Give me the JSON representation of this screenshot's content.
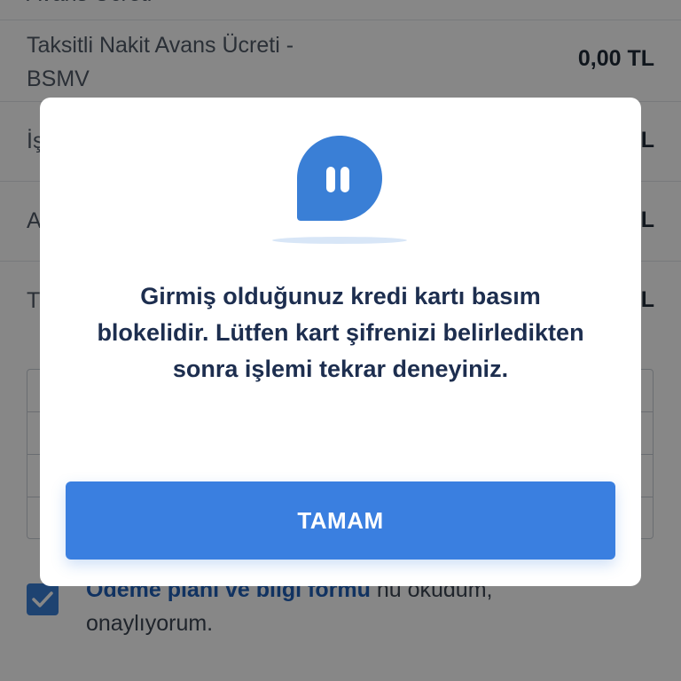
{
  "background": {
    "rows": [
      {
        "label": "Avans Ücreti",
        "value": ""
      },
      {
        "label": "Taksitli Nakit Avans Ücreti - BSMV",
        "value": "0,00 TL"
      },
      {
        "label": "İş",
        "value": "L"
      },
      {
        "label": "A",
        "value": "L"
      },
      {
        "label": "T",
        "value": "L"
      }
    ],
    "consent": {
      "checked": true,
      "link_text": "Ödeme planı ve bilgi formu",
      "rest_text": "nu okudum, onaylıyorum."
    }
  },
  "dialog": {
    "icon": "pause-chat-bubble-icon",
    "message": "Girmiş olduğunuz kredi kartı basım blokelidir. Lütfen kart şifrenizi belirledikten sonra işlemi tekrar deneyiniz.",
    "button_label": "TAMAM"
  },
  "colors": {
    "accent": "#3a7fe0",
    "message_text": "#1d2e4f",
    "overlay": "rgba(0,0,0,0.47)"
  }
}
